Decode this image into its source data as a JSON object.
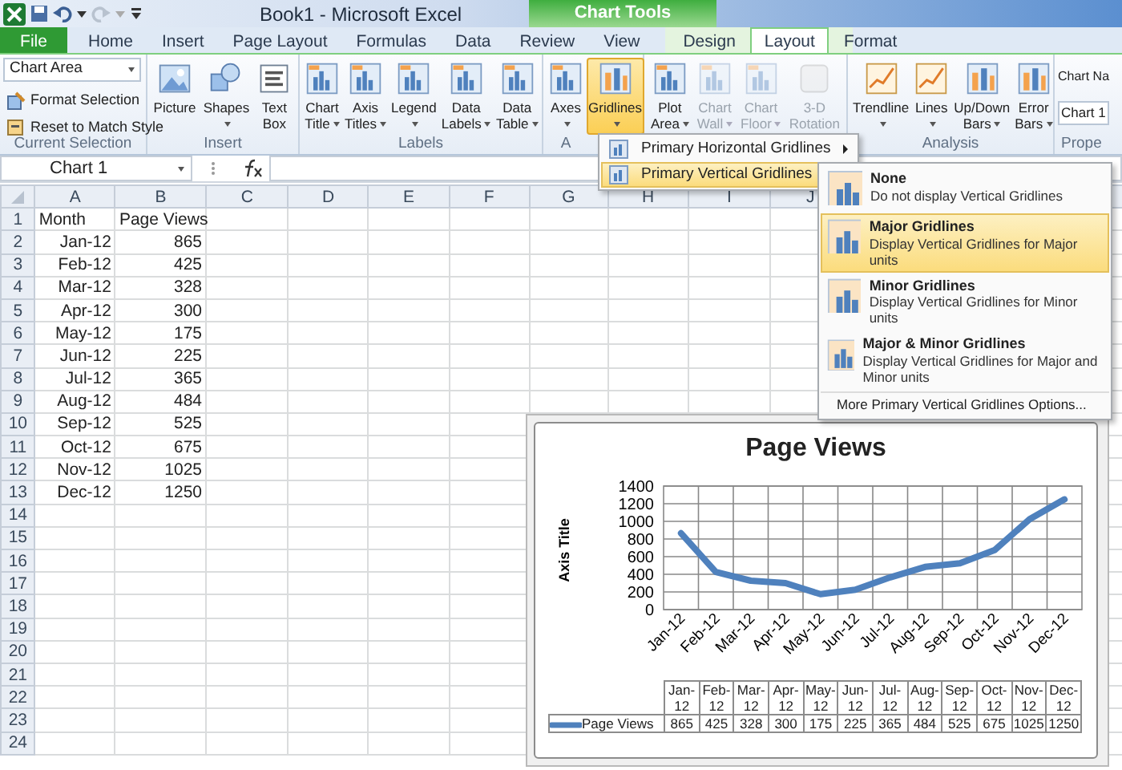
{
  "title_bar": {
    "title": "Book1 - Microsoft Excel",
    "context": "Chart Tools"
  },
  "tabs": [
    {
      "label": "File",
      "kind": "file",
      "selected": false
    },
    {
      "label": "Home",
      "kind": "plain",
      "selected": false
    },
    {
      "label": "Insert",
      "kind": "plain",
      "selected": false
    },
    {
      "label": "Page Layout",
      "kind": "plain",
      "selected": false
    },
    {
      "label": "Formulas",
      "kind": "plain",
      "selected": false
    },
    {
      "label": "Data",
      "kind": "plain",
      "selected": false
    },
    {
      "label": "Review",
      "kind": "plain",
      "selected": false
    },
    {
      "label": "View",
      "kind": "plain",
      "selected": false
    },
    {
      "label": "Design",
      "kind": "context",
      "selected": false
    },
    {
      "label": "Layout",
      "kind": "context",
      "selected": true
    },
    {
      "label": "Format",
      "kind": "context",
      "selected": false
    }
  ],
  "ribbon": {
    "groups": [
      {
        "kind": "selection",
        "label": "Current Selection",
        "dropdown": "Chart Area",
        "commands": [
          "Format Selection",
          "Reset to Match Style"
        ]
      },
      {
        "kind": "buttons",
        "label": "Insert",
        "buttons": [
          {
            "lines": [
              "Picture"
            ],
            "dropdown": false,
            "disabled": false,
            "active": false
          },
          {
            "lines": [
              "Shapes"
            ],
            "dropdown": true,
            "disabled": false,
            "active": false
          },
          {
            "lines": [
              "Text",
              "Box"
            ],
            "dropdown": false,
            "disabled": false,
            "active": false
          }
        ]
      },
      {
        "kind": "buttons",
        "label": "Labels",
        "buttons": [
          {
            "lines": [
              "Chart",
              "Title"
            ],
            "dropdown": true,
            "disabled": false,
            "active": false
          },
          {
            "lines": [
              "Axis",
              "Titles"
            ],
            "dropdown": true,
            "disabled": false,
            "active": false
          },
          {
            "lines": [
              "Legend"
            ],
            "dropdown": true,
            "disabled": false,
            "active": false
          },
          {
            "lines": [
              "Data",
              "Labels"
            ],
            "dropdown": true,
            "disabled": false,
            "active": false
          },
          {
            "lines": [
              "Data",
              "Table"
            ],
            "dropdown": true,
            "disabled": false,
            "active": false
          }
        ]
      },
      {
        "kind": "buttons",
        "label": "A",
        "buttons": [
          {
            "lines": [
              "Axes"
            ],
            "dropdown": true,
            "disabled": false,
            "active": false
          },
          {
            "lines": [
              "Gridlines"
            ],
            "dropdown": true,
            "disabled": false,
            "active": true
          }
        ]
      },
      {
        "kind": "buttons",
        "buttons": [
          {
            "lines": [
              "Plot",
              "Area"
            ],
            "dropdown": true,
            "disabled": false,
            "active": false
          },
          {
            "lines": [
              "Chart",
              "Wall"
            ],
            "dropdown": true,
            "disabled": true,
            "active": false
          },
          {
            "lines": [
              "Chart",
              "Floor"
            ],
            "dropdown": true,
            "disabled": true,
            "active": false
          },
          {
            "lines": [
              "3-D",
              "Rotation"
            ],
            "dropdown": false,
            "disabled": true,
            "active": false
          }
        ]
      },
      {
        "kind": "buttons",
        "label": "Analysis",
        "buttons": [
          {
            "lines": [
              "Trendline"
            ],
            "dropdown": true,
            "disabled": false,
            "active": false
          },
          {
            "lines": [
              "Lines"
            ],
            "dropdown": true,
            "disabled": false,
            "active": false
          },
          {
            "lines": [
              "Up/Down",
              "Bars"
            ],
            "dropdown": true,
            "disabled": false,
            "active": false
          },
          {
            "lines": [
              "Error",
              "Bars"
            ],
            "dropdown": true,
            "disabled": false,
            "active": false
          }
        ]
      },
      {
        "kind": "properties",
        "label": "Prope",
        "name_label": "Chart Na",
        "name_value": "Chart 1"
      }
    ]
  },
  "formula_bar": {
    "name_box": "Chart 1"
  },
  "sheet": {
    "columns": [
      "A",
      "B",
      "C",
      "D",
      "E",
      "F",
      "G",
      "H",
      "I",
      "J"
    ],
    "rows": [
      {
        "number": "1",
        "kind": "text",
        "cells": [
          "Month",
          "Page Views"
        ]
      },
      {
        "number": "2",
        "kind": "value",
        "cells": [
          "Jan-12",
          "865"
        ]
      },
      {
        "number": "3",
        "kind": "value",
        "cells": [
          "Feb-12",
          "425"
        ]
      },
      {
        "number": "4",
        "kind": "value",
        "cells": [
          "Mar-12",
          "328"
        ]
      },
      {
        "number": "5",
        "kind": "value",
        "cells": [
          "Apr-12",
          "300"
        ]
      },
      {
        "number": "6",
        "kind": "value",
        "cells": [
          "May-12",
          "175"
        ]
      },
      {
        "number": "7",
        "kind": "value",
        "cells": [
          "Jun-12",
          "225"
        ]
      },
      {
        "number": "8",
        "kind": "value",
        "cells": [
          "Jul-12",
          "365"
        ]
      },
      {
        "number": "9",
        "kind": "value",
        "cells": [
          "Aug-12",
          "484"
        ]
      },
      {
        "number": "10",
        "kind": "value",
        "cells": [
          "Sep-12",
          "525"
        ]
      },
      {
        "number": "11",
        "kind": "value",
        "cells": [
          "Oct-12",
          "675"
        ]
      },
      {
        "number": "12",
        "kind": "value",
        "cells": [
          "Nov-12",
          "1025"
        ]
      },
      {
        "number": "13",
        "kind": "value",
        "cells": [
          "Dec-12",
          "1250"
        ]
      },
      {
        "number": "14",
        "kind": "value"
      },
      {
        "number": "15",
        "kind": "value"
      },
      {
        "number": "16",
        "kind": "value"
      },
      {
        "number": "17",
        "kind": "value"
      },
      {
        "number": "18",
        "kind": "value"
      },
      {
        "number": "19",
        "kind": "value"
      },
      {
        "number": "20",
        "kind": "value"
      },
      {
        "number": "21",
        "kind": "value"
      },
      {
        "number": "22",
        "kind": "value"
      },
      {
        "number": "23",
        "kind": "value"
      },
      {
        "number": "24",
        "kind": "value"
      }
    ]
  },
  "gridlines_menu": {
    "items": [
      {
        "label": "Primary Horizontal Gridlines",
        "selected": false
      },
      {
        "label": "Primary Vertical Gridlines",
        "selected": true
      }
    ]
  },
  "vertical_gridlines_submenu": {
    "items": [
      {
        "title": "None",
        "description": "Do not display Vertical Gridlines",
        "selected": false
      },
      {
        "title": "Major Gridlines",
        "description": "Display Vertical Gridlines for Major units",
        "selected": true
      },
      {
        "title": "Minor Gridlines",
        "description": "Display Vertical Gridlines for Minor units",
        "selected": false
      },
      {
        "title": "Major & Minor Gridlines",
        "description": "Display Vertical Gridlines for Major and Minor units",
        "selected": false
      }
    ],
    "footer": "More Primary Vertical Gridlines Options..."
  },
  "chart": {
    "vertical_gridlines": true,
    "chart_data": {
      "type": "line",
      "title": "Page Views",
      "ylabel": "Axis Title",
      "categories": [
        "Jan-12",
        "Feb-12",
        "Mar-12",
        "Apr-12",
        "May-12",
        "Jun-12",
        "Jul-12",
        "Aug-12",
        "Sep-12",
        "Oct-12",
        "Nov-12",
        "Dec-12"
      ],
      "series": [
        {
          "name": "Page Views",
          "color": "#4f81bd",
          "values": [
            865,
            425,
            328,
            300,
            175,
            225,
            365,
            484,
            525,
            675,
            1025,
            1250
          ]
        }
      ],
      "grid": true,
      "ylim": [
        0,
        1400
      ],
      "yticks": [
        0,
        200,
        400,
        600,
        800,
        1000,
        1200,
        1400
      ]
    },
    "data_table": {
      "categories": [
        "Jan-12",
        "Feb-12",
        "Mar-12",
        "Apr-12",
        "May-12",
        "Jun-12",
        "Jul-12",
        "Aug-12",
        "Sep-12",
        "Oct-12",
        "Nov-12",
        "Dec-12"
      ],
      "values": [
        "865",
        "425",
        "328",
        "300",
        "175",
        "225",
        "365",
        "484",
        "525",
        "675",
        "1025",
        "1250"
      ]
    }
  }
}
